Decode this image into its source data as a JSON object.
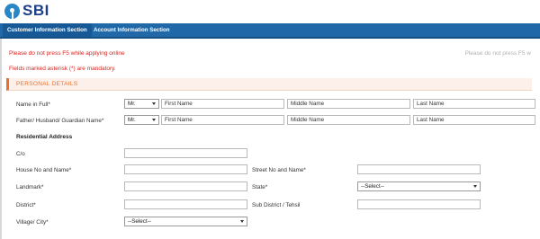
{
  "brand": {
    "name": "SBI",
    "logo_color": "#2b86c5",
    "text_color": "#1d3f88"
  },
  "tabs": [
    {
      "label": "Customer Information Section",
      "active": true
    },
    {
      "label": "Account Information Section",
      "active": false
    }
  ],
  "notices": {
    "f5_warning": "Please do not press F5 while applying online",
    "f5_warning_right": "Please do not press F5 w",
    "mandatory": "Fields marked asterisk (*) are mandatory."
  },
  "section": {
    "title": "PERSONAL DETAILS",
    "accent": "#e7702d"
  },
  "form": {
    "name_in_full": {
      "label": "Name in Full*",
      "title_value": "Mr.",
      "first_placeholder": "First Name",
      "middle_placeholder": "Middle Name",
      "last_placeholder": "Last Name"
    },
    "guardian_name": {
      "label": "Father/ Husband/ Guardian Name*",
      "title_value": "Mr.",
      "first_placeholder": "First Name",
      "middle_placeholder": "Middle Name",
      "last_placeholder": "Last Name"
    },
    "residential_address": {
      "heading": "Residential Address",
      "co_label": "C/o",
      "house_label": "House No and Name*",
      "street_label": "Street No and Name*",
      "landmark_label": "Landmark*",
      "state_label": "State*",
      "state_value": "--Select--",
      "district_label": "District*",
      "subdistrict_label": "Sub District / Tehsil",
      "village_label": "Village/ City*",
      "village_value": "--Select--"
    }
  }
}
